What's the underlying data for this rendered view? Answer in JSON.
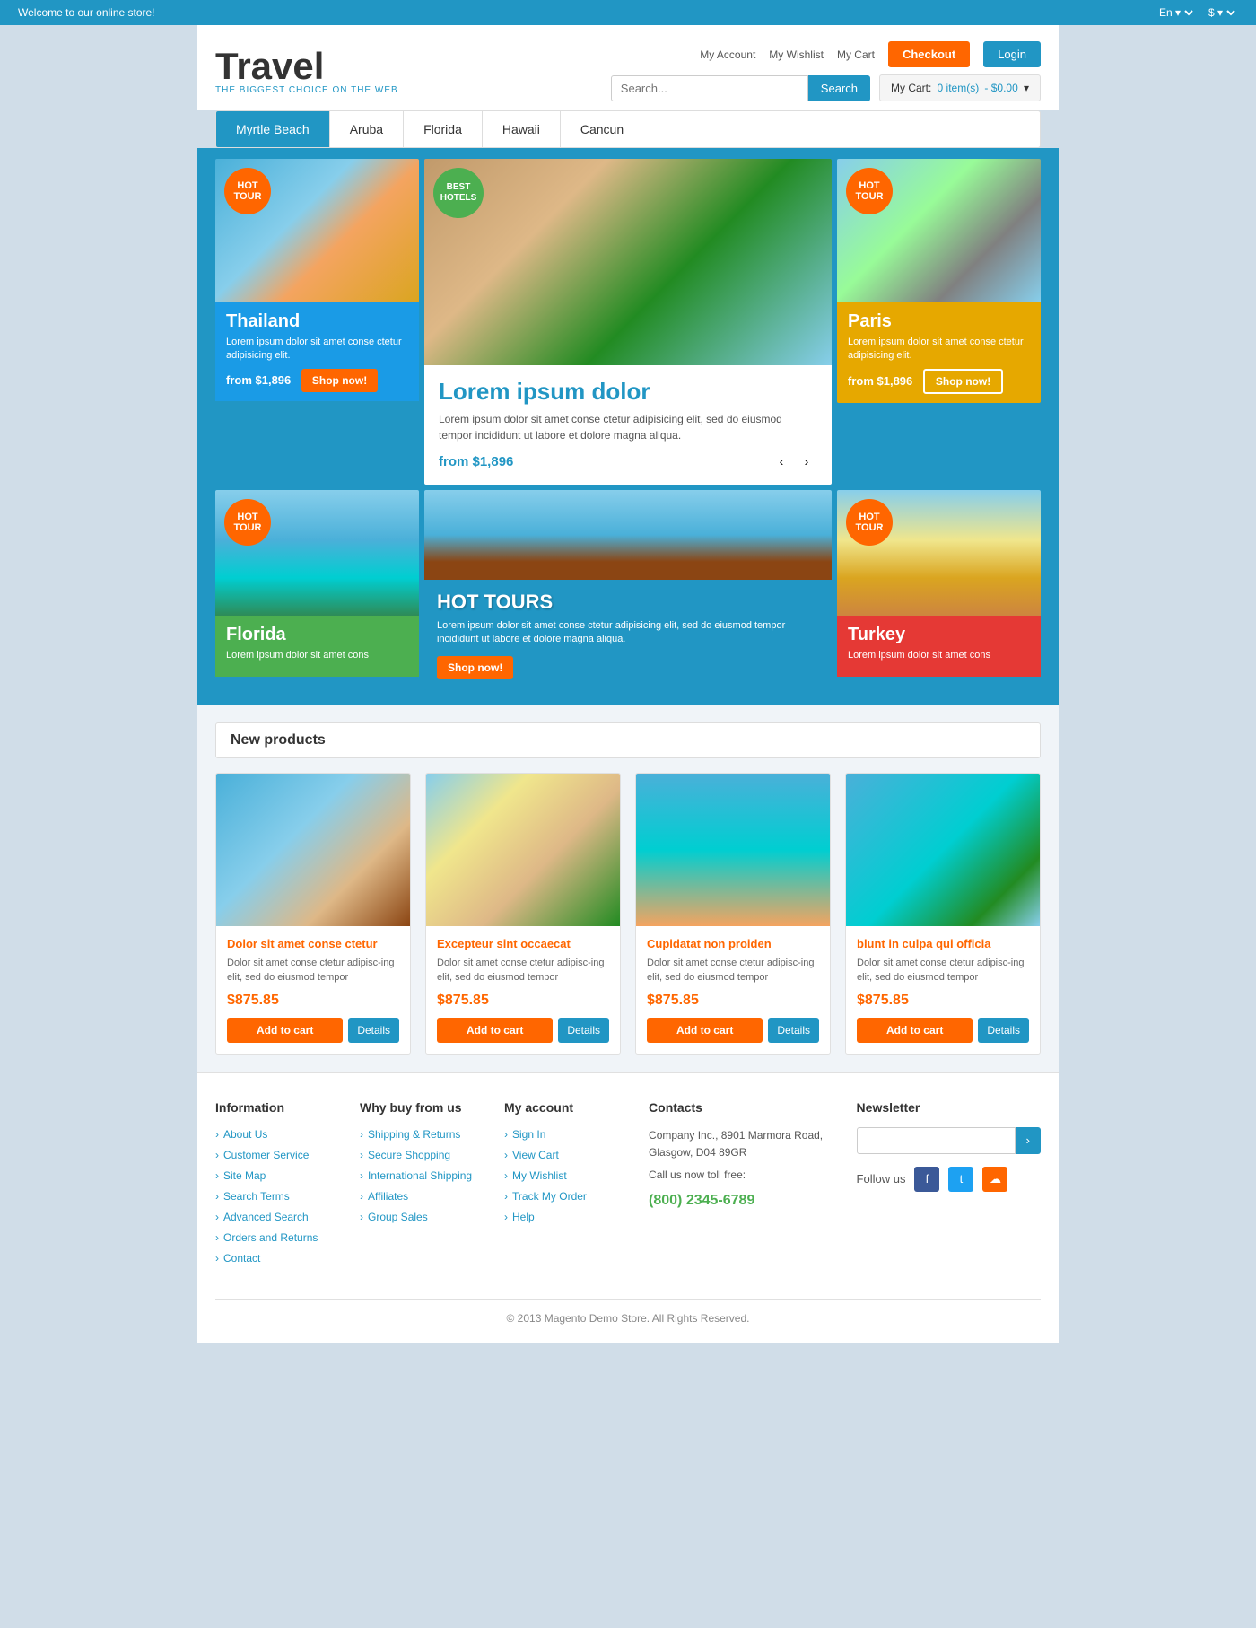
{
  "topbar": {
    "welcome": "Welcome to our online store!",
    "lang": "En",
    "currency": "$"
  },
  "header": {
    "logo_title": "Travel",
    "logo_sub": "THE BIGGEST CHOICE ON THE WEB",
    "nav": {
      "my_account": "My Account",
      "my_wishlist": "My Wishlist",
      "my_cart": "My Cart",
      "checkout": "Checkout",
      "login": "Login"
    },
    "search_placeholder": "Search...",
    "search_btn": "Search",
    "cart_label": "My Cart:",
    "cart_items": "0 item(s)",
    "cart_price": "- $0.00"
  },
  "nav_tabs": [
    {
      "label": "Myrtle Beach",
      "active": true
    },
    {
      "label": "Aruba",
      "active": false
    },
    {
      "label": "Florida",
      "active": false
    },
    {
      "label": "Hawaii",
      "active": false
    },
    {
      "label": "Cancun",
      "active": false
    }
  ],
  "banners": {
    "thailand": {
      "badge": "HOT TOUR",
      "title": "Thailand",
      "desc": "Lorem ipsum dolor sit amet conse ctetur adipisicing elit.",
      "price": "from $1,896",
      "btn": "Shop now!"
    },
    "center": {
      "badge": "BEST HOTELS",
      "title": "Lorem ipsum dolor",
      "desc": "Lorem ipsum dolor sit amet conse ctetur adipisicing elit, sed do eiusmod tempor incididunt ut labore et dolore magna aliqua.",
      "price": "from $1,896"
    },
    "paris": {
      "badge": "HOT TOUR",
      "title": "Paris",
      "desc": "Lorem ipsum dolor sit amet conse ctetur adipisicing elit.",
      "price": "from $1,896",
      "btn": "Shop now!"
    },
    "florida": {
      "badge": "HOT TOUR",
      "title": "Florida",
      "desc": "Lorem ipsum dolor sit amet cons"
    },
    "hottours": {
      "title": "HOT TOURS",
      "desc": "Lorem ipsum dolor sit amet conse ctetur adipisicing elit, sed do eiusmod tempor incididunt ut labore et dolore magna aliqua.",
      "btn": "Shop now!"
    },
    "turkey": {
      "badge": "HOT TOUR",
      "title": "Turkey",
      "desc": "Lorem ipsum dolor sit amet cons"
    }
  },
  "new_products": {
    "section_title": "New products",
    "products": [
      {
        "name": "Dolor sit amet conse ctetur",
        "desc": "Dolor sit amet conse ctetur adipisc-ing elit, sed do eiusmod tempor",
        "price": "$875.85",
        "add_cart": "Add to cart",
        "details": "Details"
      },
      {
        "name": "Excepteur sint occaecat",
        "desc": "Dolor sit amet conse ctetur adipisc-ing elit, sed do eiusmod tempor",
        "price": "$875.85",
        "add_cart": "Add to cart",
        "details": "Details"
      },
      {
        "name": "Cupidatat non proiden",
        "desc": "Dolor sit amet conse ctetur adipisc-ing elit, sed do eiusmod tempor",
        "price": "$875.85",
        "add_cart": "Add to cart",
        "details": "Details"
      },
      {
        "name": "blunt in culpa qui officia",
        "desc": "Dolor sit amet conse ctetur adipisc-ing elit, sed do eiusmod tempor",
        "price": "$875.85",
        "add_cart": "Add to cart",
        "details": "Details"
      }
    ]
  },
  "footer": {
    "information": {
      "title": "Information",
      "links": [
        "About Us",
        "Customer Service",
        "Site Map",
        "Search Terms",
        "Advanced Search",
        "Orders and Returns",
        "Contact"
      ]
    },
    "why_buy": {
      "title": "Why buy from us",
      "links": [
        "Shipping & Returns",
        "Secure Shopping",
        "International Shipping",
        "Affiliates",
        "Group Sales"
      ]
    },
    "my_account": {
      "title": "My account",
      "links": [
        "Sign In",
        "View Cart",
        "My Wishlist",
        "Track My Order",
        "Help"
      ]
    },
    "contacts": {
      "title": "Contacts",
      "address": "Company Inc., 8901 Marmora Road, Glasgow, D04 89GR",
      "call_label": "Call us now toll free:",
      "phone": "(800) 2345-6789"
    },
    "newsletter": {
      "title": "Newsletter",
      "placeholder": "",
      "btn": "›",
      "follow_label": "Follow us"
    },
    "copyright": "© 2013 Magento Demo Store. All Rights Reserved."
  }
}
